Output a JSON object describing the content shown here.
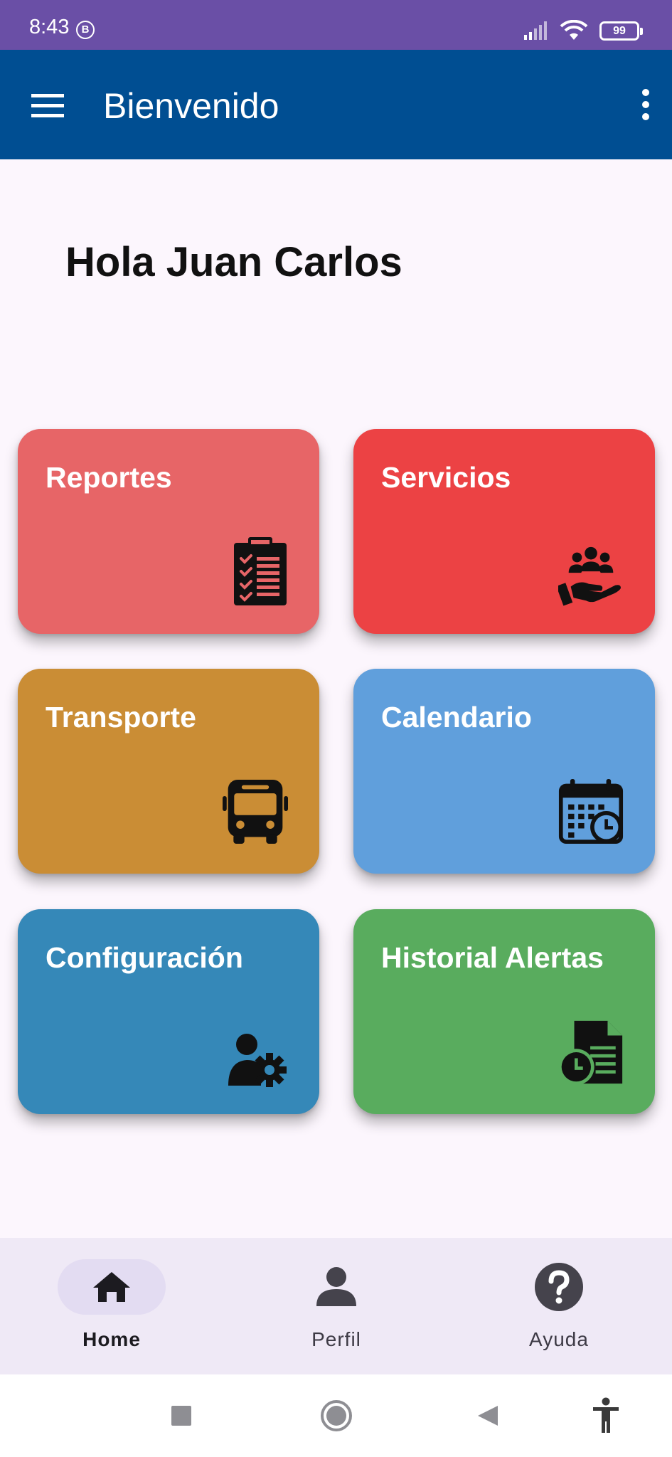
{
  "status_bar": {
    "time": "8:43",
    "b_badge": "B",
    "battery": "99"
  },
  "app_bar": {
    "title": "Bienvenido"
  },
  "greeting": "Hola Juan Carlos",
  "tiles": [
    {
      "label": "Reportes",
      "icon": "clipboard-checklist-icon",
      "color": "#e76567"
    },
    {
      "label": "Servicios",
      "icon": "hand-group-icon",
      "color": "#ec4244"
    },
    {
      "label": "Transporte",
      "icon": "bus-icon",
      "color": "#ca8d35"
    },
    {
      "label": "Calendario",
      "icon": "calendar-clock-icon",
      "color": "#609fdc"
    },
    {
      "label": "Configuración",
      "icon": "user-gear-icon",
      "color": "#3588b8"
    },
    {
      "label": "Historial Alertas",
      "icon": "document-clock-icon",
      "color": "#59ac5e"
    }
  ],
  "bottom_nav": {
    "items": [
      {
        "label": "Home",
        "icon": "home-icon",
        "active": true
      },
      {
        "label": "Perfil",
        "icon": "person-icon",
        "active": false
      },
      {
        "label": "Ayuda",
        "icon": "help-icon",
        "active": false
      }
    ]
  },
  "colors": {
    "status_bar": "#6a4fa6",
    "app_bar": "#004e92",
    "background": "#fcf6fd",
    "nav_background": "#efe9f6"
  }
}
